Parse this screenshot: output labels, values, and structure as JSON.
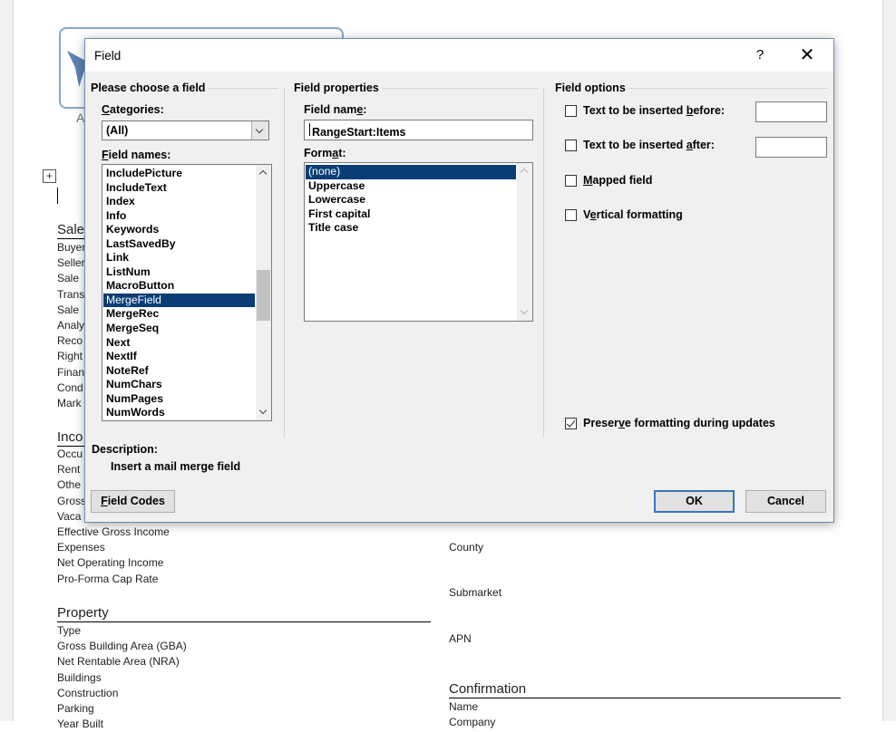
{
  "document": {
    "logo_letter": "A",
    "sections": {
      "sale": {
        "heading": "Sale",
        "items": [
          "Buyer",
          "Seller",
          "Sale",
          "Trans",
          "Sale",
          "Analy",
          "Reco",
          "Right",
          "Finan",
          "Cond",
          "Mark"
        ]
      },
      "income": {
        "heading": "Inco",
        "items": [
          "Occu",
          "Rent",
          "Othe",
          "Gross",
          "Vaca",
          "Effective Gross Income",
          "Expenses",
          "Net Operating Income",
          "Pro-Forma Cap Rate"
        ]
      },
      "property": {
        "heading": "Property",
        "items": [
          "Type",
          "Gross Building Area (GBA)",
          "Net Rentable Area (NRA)",
          "Buildings",
          "Construction",
          "Parking",
          "Year Built"
        ]
      },
      "right_column": {
        "county": "County",
        "submarket": "Submarket",
        "apn": "APN"
      },
      "confirmation": {
        "heading": "Confirmation",
        "items": [
          "Name",
          "Company"
        ]
      }
    }
  },
  "dialog": {
    "title": "Field",
    "help": "?",
    "close": "✕",
    "choose": {
      "group_label": "Please choose a field",
      "categories_label": "Categories:",
      "categories_value": "(All)",
      "field_names_label": "Field names:",
      "field_names": [
        "IncludePicture",
        "IncludeText",
        "Index",
        "Info",
        "Keywords",
        "LastSavedBy",
        "Link",
        "ListNum",
        "MacroButton",
        "MergeField",
        "MergeRec",
        "MergeSeq",
        "Next",
        "NextIf",
        "NoteRef",
        "NumChars",
        "NumPages",
        "NumWords"
      ],
      "selected_field": "MergeField"
    },
    "properties": {
      "group_label": "Field properties",
      "field_name_label": "Field name:",
      "field_name_value": "RangeStart:Items",
      "format_label": "Format:",
      "formats": [
        "(none)",
        "Uppercase",
        "Lowercase",
        "First capital",
        "Title case"
      ],
      "selected_format": "(none)"
    },
    "options": {
      "group_label": "Field options",
      "text_before_label": "Text to be inserted before:",
      "text_before_value": "",
      "text_after_label": "Text to be inserted after:",
      "text_after_value": "",
      "mapped_label": "Mapped field",
      "vertical_label": "Vertical formatting",
      "preserve_label": "Preserve formatting during updates",
      "text_before_checked": false,
      "text_after_checked": false,
      "mapped_checked": false,
      "vertical_checked": false,
      "preserve_checked": true
    },
    "description": {
      "label": "Description:",
      "text": "Insert a mail merge field"
    },
    "buttons": {
      "field_codes": "Field Codes",
      "ok": "OK",
      "cancel": "Cancel"
    }
  }
}
